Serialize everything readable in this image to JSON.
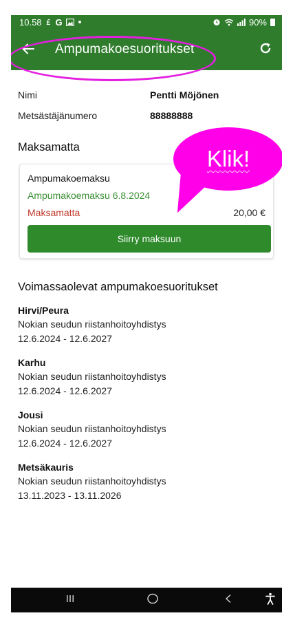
{
  "status_bar": {
    "time": "10.58",
    "left_icons": [
      "money-icon",
      "google-icon",
      "gallery-icon",
      "dot-icon"
    ],
    "battery": "90%",
    "right_icons": [
      "alarm-icon",
      "wifi-icon",
      "signal-icon",
      "battery-icon"
    ]
  },
  "app_bar": {
    "title": "Ampumakoesuoritukset",
    "back_icon": "back-arrow-icon",
    "refresh_icon": "refresh-icon",
    "color": "#2f7d2c"
  },
  "profile": {
    "name_label": "Nimi",
    "name_value": "Pentti Möjönen",
    "hunter_label": "Metsästäjänumero",
    "hunter_value": "88888888"
  },
  "unpaid": {
    "section_title": "Maksamatta",
    "card": {
      "title": "Ampumakoemaksu",
      "subtitle": "Ampumakoemaksu 6.8.2024",
      "status": "Maksamatta",
      "amount": "20,00 €",
      "button_label": "Siirry maksuun"
    }
  },
  "annotation": {
    "bubble_text": "Klik!",
    "highlight_color": "#ff00e8"
  },
  "valid": {
    "section_title": "Voimassaolevat ampumakoesuoritukset",
    "items": [
      {
        "name": "Hirvi/Peura",
        "org": "Nokian seudun riistanhoitoyhdistys",
        "dates": "12.6.2024 - 12.6.2027"
      },
      {
        "name": "Karhu",
        "org": "Nokian seudun riistanhoitoyhdistys",
        "dates": "12.6.2024 - 12.6.2027"
      },
      {
        "name": "Jousi",
        "org": "Nokian seudun riistanhoitoyhdistys",
        "dates": "12.6.2024 - 12.6.2027"
      },
      {
        "name": "Metsäkauris",
        "org": "Nokian seudun riistanhoitoyhdistys",
        "dates": "13.11.2023 - 13.11.2026"
      }
    ]
  },
  "nav_bar": {
    "buttons": [
      "recent-apps-icon",
      "home-icon",
      "back-icon",
      "accessibility-icon"
    ]
  }
}
